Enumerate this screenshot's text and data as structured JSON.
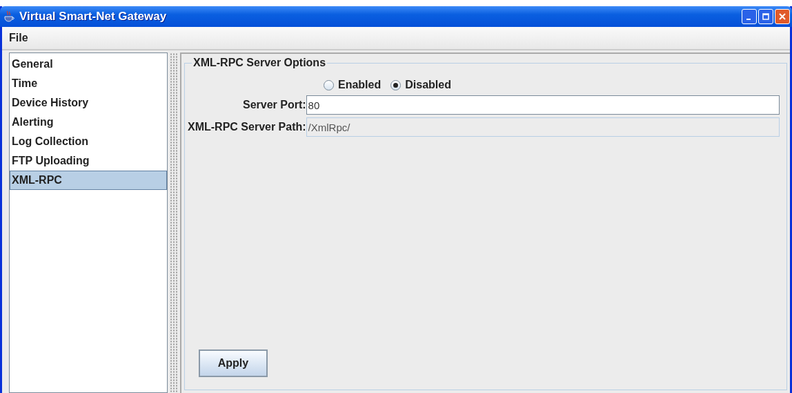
{
  "window": {
    "title": "Virtual Smart-Net Gateway"
  },
  "menu": [
    "File"
  ],
  "sidebar": {
    "items": [
      {
        "label": "General",
        "selected": false
      },
      {
        "label": "Time",
        "selected": false
      },
      {
        "label": "Device History",
        "selected": false
      },
      {
        "label": "Alerting",
        "selected": false
      },
      {
        "label": "Log Collection",
        "selected": false
      },
      {
        "label": "FTP Uploading",
        "selected": false
      },
      {
        "label": "XML-RPC",
        "selected": true
      }
    ]
  },
  "panel": {
    "title": "XML-RPC Server Options",
    "radios": [
      {
        "label": "Enabled",
        "selected": false
      },
      {
        "label": "Disabled",
        "selected": true
      }
    ],
    "fields": [
      {
        "label": "Server Port:",
        "value": "80",
        "disabled": false
      },
      {
        "label": "XML-RPC Server Path:",
        "value": "/XmlRpc/",
        "disabled": true
      }
    ],
    "button": "Apply"
  }
}
